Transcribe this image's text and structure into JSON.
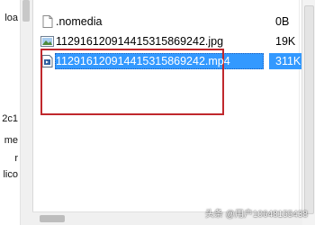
{
  "left_pane": {
    "fragments": [
      "loa",
      "2c1",
      "me",
      "r",
      "lico"
    ]
  },
  "files": [
    {
      "name": ".nomedia",
      "size": "0B",
      "icon": "blank-file-icon"
    },
    {
      "name": "1129161209144153158692​42.jpg",
      "size": "19K",
      "icon": "image-file-icon"
    },
    {
      "name": "1129161209144153158692​42.mp4",
      "size": "311K",
      "icon": "video-file-icon"
    }
  ],
  "watermark": "头条 @用户10648155438",
  "colors": {
    "selection": "#3399ff",
    "highlight_border": "#c0282d"
  }
}
